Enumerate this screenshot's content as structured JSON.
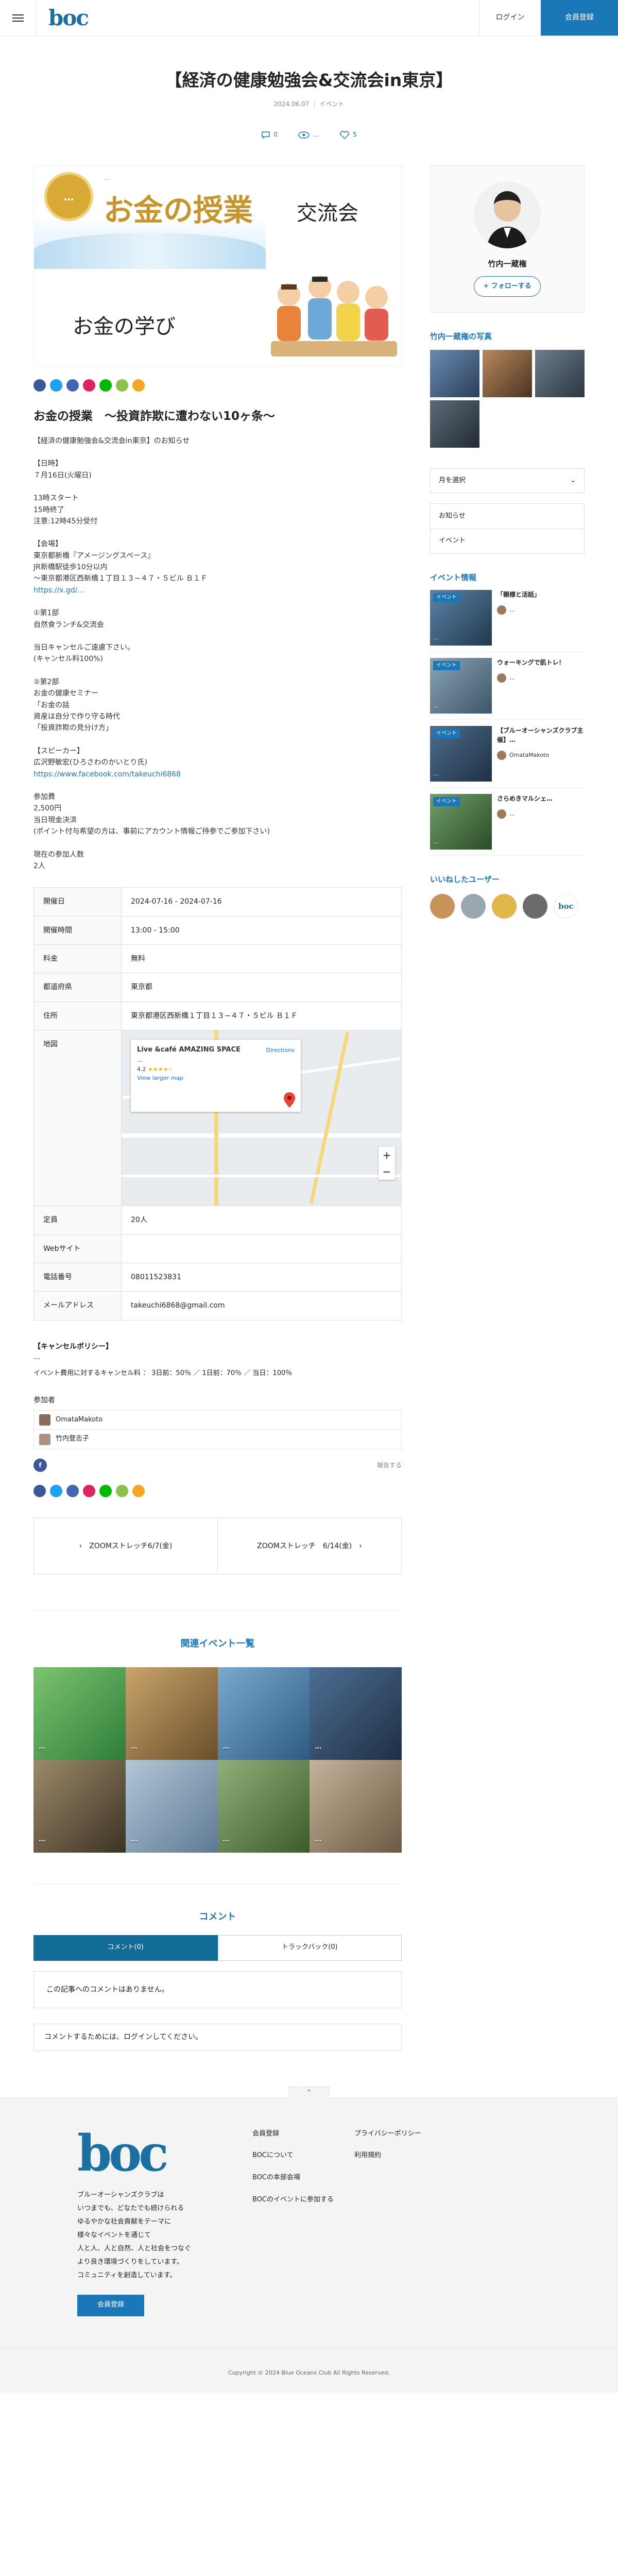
{
  "header": {
    "logo": "boc",
    "login": "ログイン",
    "register": "会員登録"
  },
  "page": {
    "title": "【経済の健康勉強会&交流会in東京】",
    "date": "2024.06.07",
    "category": "イベント",
    "comments": "0",
    "views": "…",
    "likes": "5"
  },
  "hero": {
    "badge": "…",
    "subtitle": "…",
    "main": "お金の授業",
    "koryu": "交流会",
    "manabi": "お金の学び"
  },
  "article": {
    "heading": "お金の授業　～投資詐欺に遭わない10ヶ条～",
    "lead": "【経済の健康勉強会&交流会in東京】のお知らせ",
    "paragraphs": [
      "【日時】\n７月16日(火曜日)",
      "13時スタート\n15時終了\n注意:12時45分受付",
      "【会場】\n東京都新橋『アメージングスペース』\nJR新橋駅徒歩10分以内\n～東京都港区西新橋１丁目１３−４７・５ビル Ｂ１Ｆ",
      "①第1部\n自然食ランチ&交流会",
      "当日キャンセルご遠慮下さい。\n(キャンセル料100%)",
      "②第2部\nお金の健康セミナー\n「お金の話\n資産は自分で作り守る時代\n「投資詐欺の見分け方」",
      "【スピーカー】\n広沢野敏宏(ひろさわのかいとり氏)",
      "参加費\n2,500円\n当日現金決済\n(ポイント付与希望の方は、事前にアカウント情報ご持参でご参加下さい)",
      "現在の参加人数\n2人"
    ],
    "link_short": "https://x.gd/…",
    "link_fb": "https://www.facebook.com/takeuchi6868"
  },
  "info": {
    "rows": [
      {
        "k": "開催日",
        "v": "2024-07-16 - 2024-07-16"
      },
      {
        "k": "開催時間",
        "v": "13:00 - 15:00"
      },
      {
        "k": "料金",
        "v": "無料"
      },
      {
        "k": "都道府県",
        "v": "東京都"
      },
      {
        "k": "住所",
        "v": "東京都港区西新橋１丁目１３−４７・５ビル Ｂ１Ｆ"
      }
    ],
    "map_label": "地図",
    "map_place": "Live &café AMAZING SPACE",
    "map_addr": "…",
    "map_rating": "4.2",
    "map_larger": "View larger map",
    "map_directions": "Directions",
    "rows2": [
      {
        "k": "定員",
        "v": "20人"
      },
      {
        "k": "Webサイト",
        "v": ""
      },
      {
        "k": "電話番号",
        "v": "08011523831"
      },
      {
        "k": "メールアドレス",
        "v": "takeuchi6868@gmail.com"
      }
    ]
  },
  "policy": {
    "title": "【キャンセルポリシー】",
    "text": "…",
    "fees": "イベント費用に対するキャンセル料 ： 3日前：50％ ／ 1日前：70％ ／ 当日：100％"
  },
  "participants": {
    "label": "参加者",
    "list": [
      "OmataMakoto",
      "竹内登志子"
    ]
  },
  "report": "報告する",
  "prevnext": {
    "prev": "ZOOMストレッチ6/7(金)",
    "next": "ZOOMストレッチ　6/14(金)"
  },
  "related": {
    "title": "関連イベント一覧",
    "items": [
      "…",
      "…",
      "…",
      "…",
      "…",
      "…",
      "…",
      "…"
    ]
  },
  "comments": {
    "title": "コメント",
    "tab1": "コメント(0)",
    "tab2": "トラックバック(0)",
    "empty": "この記事へのコメントはありません。",
    "note": "コメントするためには、ログインしてください。"
  },
  "sidebar": {
    "name": "竹内一蔵権",
    "follow": "+ フォローする",
    "photos_title": "竹内一蔵権の写真",
    "month": "月を選択",
    "list": [
      "お知らせ",
      "イベント"
    ],
    "events_title": "イベント情報",
    "events": [
      {
        "title": "「親様と活話」",
        "date": "…",
        "user": "…"
      },
      {
        "title": "ウォーキングで肌トレ！",
        "date": "…",
        "user": "…"
      },
      {
        "title": "【ブルーオーシャンズクラブ主催】…",
        "date": "…",
        "user": "OmataMakoto"
      },
      {
        "title": "さらめきマルシェ…",
        "date": "…",
        "user": "…"
      }
    ],
    "likers_title": "いいねしたユーザー"
  },
  "footer": {
    "logo": "boc",
    "desc": "ブルーオーシャンズクラブは\nいつまでも、どなたでも続けられる\nゆるやかな社会貢献をテーマに\n様々なイベントを通じて\n人と人、人と自然、人と社会をつなぐ\nより良き環境づくりをしています。\nコミュニティを創造しています。",
    "register": "会員登録",
    "col1": [
      "会員登録",
      "BOCについて",
      "BOCの本部会場",
      "BOCのイベントに参加する"
    ],
    "col2": [
      "プライバシーポリシー",
      "利用規約"
    ],
    "copyright": "Copyright © 2024 Blue Oceans Club All Rights Reserved."
  },
  "colors": {
    "accent": "#1a78b8",
    "tab_active": "#126c98"
  }
}
